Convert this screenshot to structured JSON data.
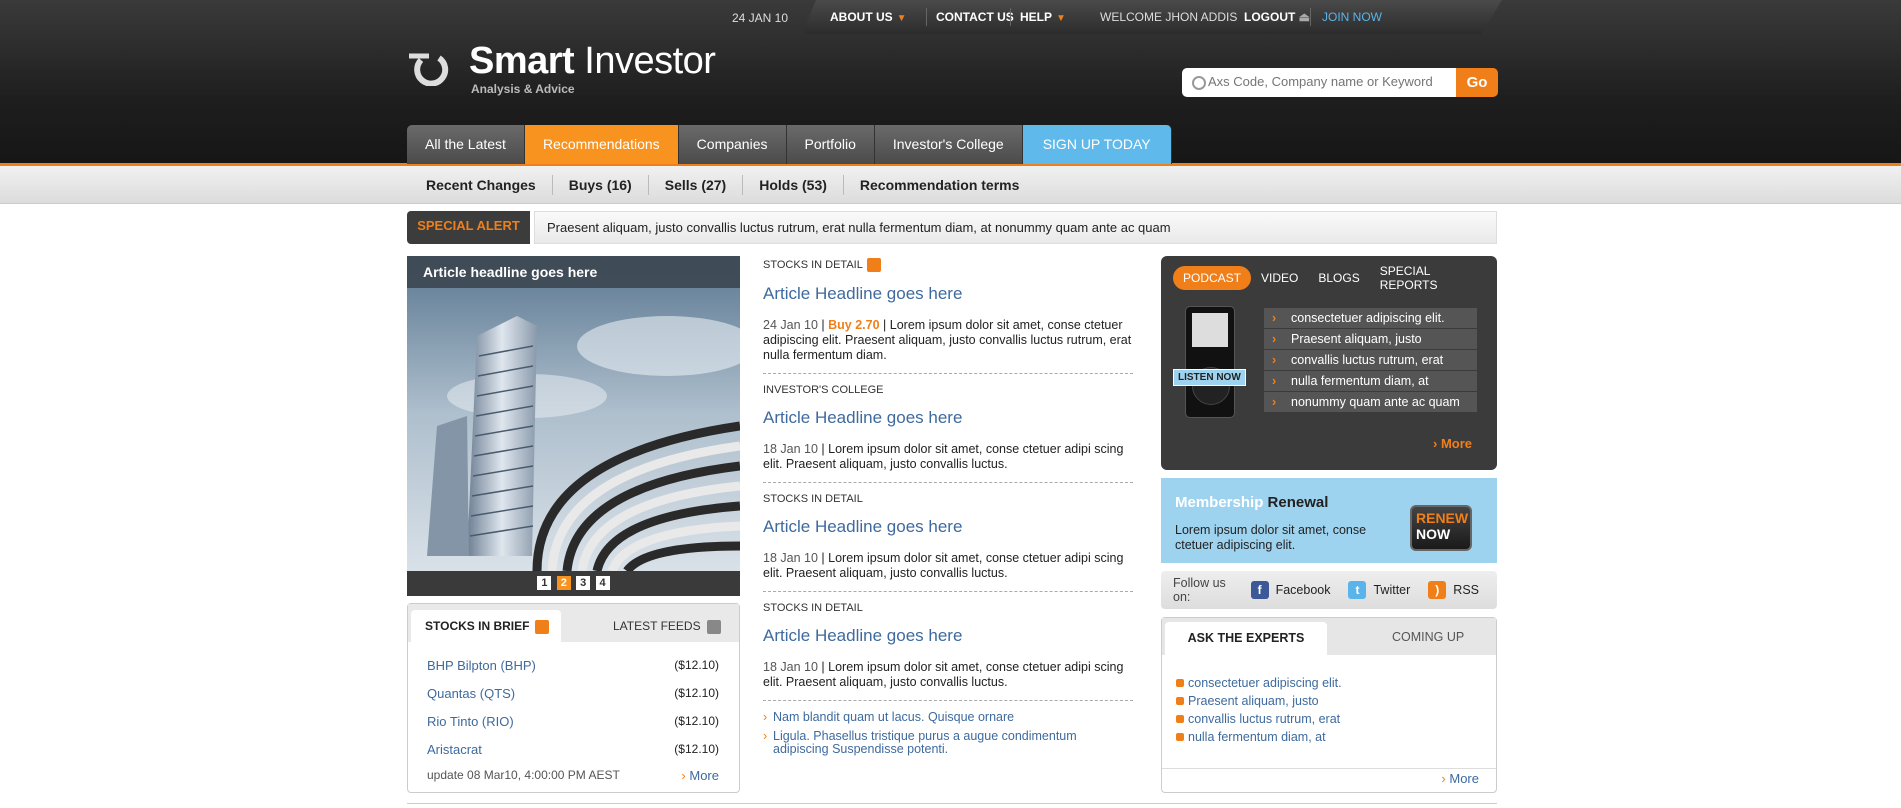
{
  "topbar": {
    "date": "24 JAN 10",
    "about_label": "ABOUT US",
    "contact_label": "CONTACT US",
    "help_label": "HELP",
    "welcome": "WELCOME JHON ADDIS",
    "logout_label": "LOGOUT",
    "join_label": "JOIN NOW"
  },
  "brand": {
    "name_bold": "Smart",
    "name_rest": " Investor",
    "tagline": "Analysis & Advice"
  },
  "search": {
    "placeholder": "Axs Code, Company name or Keyword",
    "button_label": "Go"
  },
  "main_nav": {
    "tabs": [
      {
        "label": "All the Latest"
      },
      {
        "label": "Recommendations"
      },
      {
        "label": "Companies"
      },
      {
        "label": "Portfolio"
      },
      {
        "label": "Investor's College"
      },
      {
        "label": "SIGN UP TODAY"
      }
    ]
  },
  "sub_nav": {
    "items": [
      {
        "label": "Recent Changes"
      },
      {
        "label": "Buys (16)"
      },
      {
        "label": "Sells (27)"
      },
      {
        "label": "Holds (53)"
      },
      {
        "label": "Recommendation terms"
      }
    ]
  },
  "alert": {
    "label": "SPECIAL ALERT",
    "text": "Praesent aliquam, justo convallis luctus rutrum, erat nulla fermentum diam, at nonummy quam ante ac quam"
  },
  "feature": {
    "headline": "Article headline goes here",
    "pages": [
      "1",
      "2",
      "3",
      "4"
    ]
  },
  "stocks_brief": {
    "tab_active": "STOCKS IN BRIEF",
    "tab_other": "LATEST FEEDS",
    "rows": [
      {
        "name": "BHP Bilpton (BHP)",
        "price": "($12.10)"
      },
      {
        "name": "Quantas (QTS)",
        "price": "($12.10)"
      },
      {
        "name": "Rio Tinto (RIO)",
        "price": "($12.10)"
      },
      {
        "name": "Aristacrat",
        "price": "($12.10)"
      }
    ],
    "update": "update 08 Mar10, 4:00:00 PM AEST",
    "more": "More"
  },
  "stories": [
    {
      "section": "STOCKS IN DETAIL",
      "headline": "Article Headline goes here",
      "date": "24 Jan 10",
      "buy": "Buy 2.70",
      "body": "Lorem ipsum dolor sit amet, conse ctetuer adipiscing elit. Praesent aliquam, justo convallis luctus rutrum, erat nulla fermentum diam."
    },
    {
      "section": "INVESTOR'S COLLEGE",
      "headline": "Article Headline goes here",
      "date": "18 Jan 10",
      "body": "Lorem ipsum dolor sit amet, conse ctetuer adipi scing elit. Praesent aliquam, justo convallis luctus."
    },
    {
      "section": "STOCKS IN DETAIL",
      "headline": "Article Headline goes here",
      "date": "18 Jan 10",
      "body": "Lorem ipsum dolor sit amet, conse ctetuer adipi scing elit. Praesent aliquam, justo convallis luctus."
    },
    {
      "section": "STOCKS IN DETAIL",
      "headline": "Article Headline goes here",
      "date": "18 Jan 10",
      "body": "Lorem ipsum dolor sit amet, conse ctetuer adipi scing elit. Praesent aliquam, justo convallis luctus."
    }
  ],
  "more_links": [
    "Nam blandit quam ut lacus. Quisque ornare",
    "Ligula. Phasellus tristique purus a augue condimentum adipiscing Suspendisse potenti."
  ],
  "podcast": {
    "tabs": [
      "PODCAST",
      "VIDEO",
      "BLOGS",
      "SPECIAL REPORTS"
    ],
    "listen": "LISTEN NOW",
    "items": [
      "consectetuer adipiscing elit.",
      "Praesent aliquam, justo",
      "convallis luctus rutrum, erat",
      "nulla fermentum diam, at",
      "nonummy quam ante ac quam"
    ],
    "more": "More"
  },
  "renew": {
    "title_a": "Membership",
    "title_b": "Renewal",
    "text": "Lorem ipsum dolor sit amet, conse ctetuer adipiscing elit.",
    "btn_a": "RENEW",
    "btn_b": "NOW"
  },
  "follow": {
    "label": "Follow us on:",
    "facebook": "Facebook",
    "twitter": "Twitter",
    "rss": "RSS"
  },
  "experts": {
    "tab_active": "ASK THE EXPERTS",
    "tab_other": "COMING UP",
    "items": [
      "consectetuer adipiscing elit.",
      "Praesent aliquam, justo",
      "convallis luctus rutrum, erat",
      "nulla fermentum diam, at"
    ],
    "more": "More"
  },
  "colors": {
    "accent": "#f07f1a",
    "signup": "#5fb9ea",
    "link": "#3e6a9e"
  }
}
